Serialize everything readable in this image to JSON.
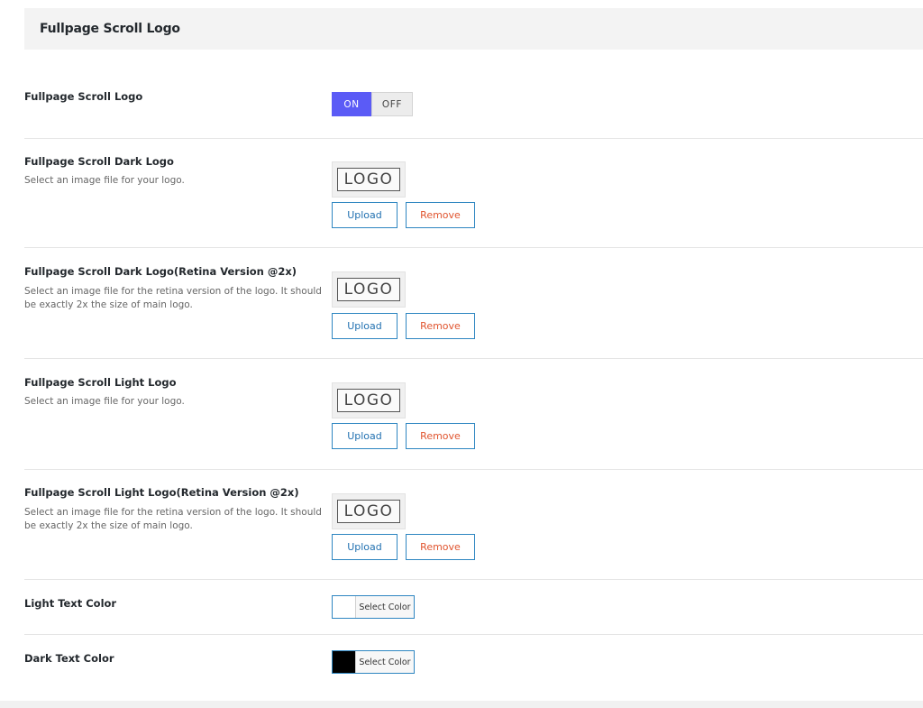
{
  "panel": {
    "title": "Fullpage Scroll Logo"
  },
  "scroll_logo": {
    "label": "Fullpage Scroll Logo",
    "on_label": "ON",
    "off_label": "OFF",
    "state": "on"
  },
  "dark_logo": {
    "label": "Fullpage Scroll Dark Logo",
    "description": "Select an image file for your logo.",
    "preview_text": "LOGO",
    "upload_label": "Upload",
    "remove_label": "Remove"
  },
  "dark_logo_retina": {
    "label": "Fullpage Scroll Dark Logo(Retina Version @2x)",
    "description": "Select an image file for the retina version of the logo. It should be exactly 2x the size of main logo.",
    "preview_text": "LOGO",
    "upload_label": "Upload",
    "remove_label": "Remove"
  },
  "light_logo": {
    "label": "Fullpage Scroll Light Logo",
    "description": "Select an image file for your logo.",
    "preview_text": "LOGO",
    "upload_label": "Upload",
    "remove_label": "Remove"
  },
  "light_logo_retina": {
    "label": "Fullpage Scroll Light Logo(Retina Version @2x)",
    "description": "Select an image file for the retina version of the logo. It should be exactly 2x the size of main logo.",
    "preview_text": "LOGO",
    "upload_label": "Upload",
    "remove_label": "Remove"
  },
  "light_text_color": {
    "label": "Light Text Color",
    "button_label": "Select Color",
    "color": "#ffffff"
  },
  "dark_text_color": {
    "label": "Dark Text Color",
    "button_label": "Select Color",
    "color": "#000000"
  },
  "colors": {
    "toggle_on": "#5b5bf6",
    "upload_text": "#2271b1",
    "remove_text": "#e0542e",
    "button_border": "#2e86c1"
  }
}
